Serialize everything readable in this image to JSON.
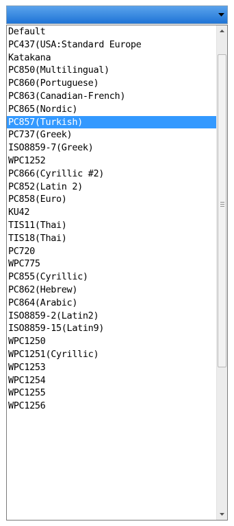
{
  "combo": {
    "selected_value": ""
  },
  "dropdown": {
    "selected_index": 7,
    "options": [
      "Default",
      "PC437(USA:Standard Europe",
      "Katakana",
      "PC850(Multilingual)",
      "PC860(Portuguese)",
      "PC863(Canadian-French)",
      "PC865(Nordic)",
      "PC857(Turkish)",
      "PC737(Greek)",
      "ISO8859-7(Greek)",
      "WPC1252",
      "PC866(Cyrillic #2)",
      "PC852(Latin 2)",
      "PC858(Euro)",
      "KU42",
      "TIS11(Thai)",
      "TIS18(Thai)",
      "PC720",
      "WPC775",
      "PC855(Cyrillic)",
      "PC862(Hebrew)",
      "PC864(Arabic)",
      "ISO8859-2(Latin2)",
      "ISO8859-15(Latin9)",
      "WPC1250",
      "WPC1251(Cyrillic)",
      "WPC1253",
      "WPC1254",
      "WPC1255",
      "WPC1256"
    ]
  },
  "icons": {
    "combo_arrow": "chevron-down-icon",
    "scroll_up": "scroll-up-arrow-icon",
    "scroll_down": "scroll-down-arrow-icon"
  },
  "colors": {
    "selection": "#3399ff",
    "combo_fill": "#2f86df"
  }
}
